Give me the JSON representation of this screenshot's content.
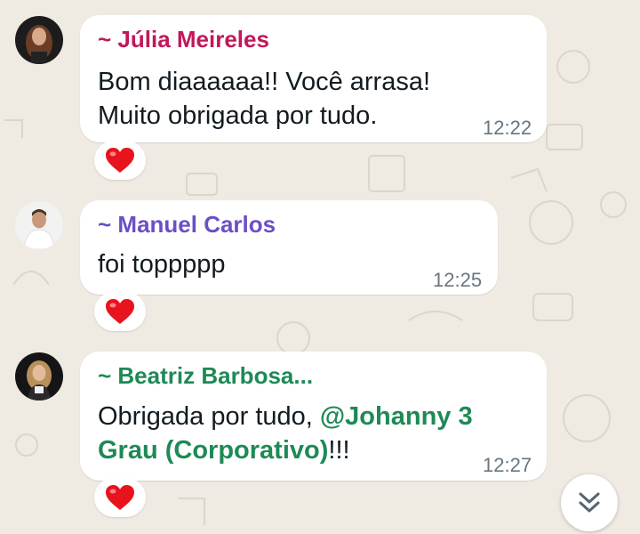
{
  "messages": [
    {
      "sender": "~ Júlia Meireles",
      "sender_color": "#c2185b",
      "lines": [
        "Bom diaaaaaa!! Você arrasa!",
        "Muito obrigada por tudo."
      ],
      "time": "12:22",
      "reaction": "heart"
    },
    {
      "sender": "~ Manuel Carlos",
      "sender_color": "#6c4fc7",
      "lines": [
        "foi toppppp"
      ],
      "time": "12:25",
      "reaction": "heart"
    },
    {
      "sender": "~ Beatriz Barbosa...",
      "sender_color": "#1e8a56",
      "text_start": "Obrigada por tudo, ",
      "mention_line1": "@Johanny 3",
      "mention_line2": "Grau (Corporativo)",
      "text_end": "!!!",
      "time": "12:27",
      "reaction": "heart"
    }
  ],
  "colors": {
    "background": "#efeae2",
    "bubble": "#ffffff",
    "timestamp": "#667781",
    "mention": "#1e8a56",
    "heart": "#e8131d"
  },
  "icons": {
    "reaction": "heart-icon",
    "scroll": "double-chevron-down-icon"
  }
}
